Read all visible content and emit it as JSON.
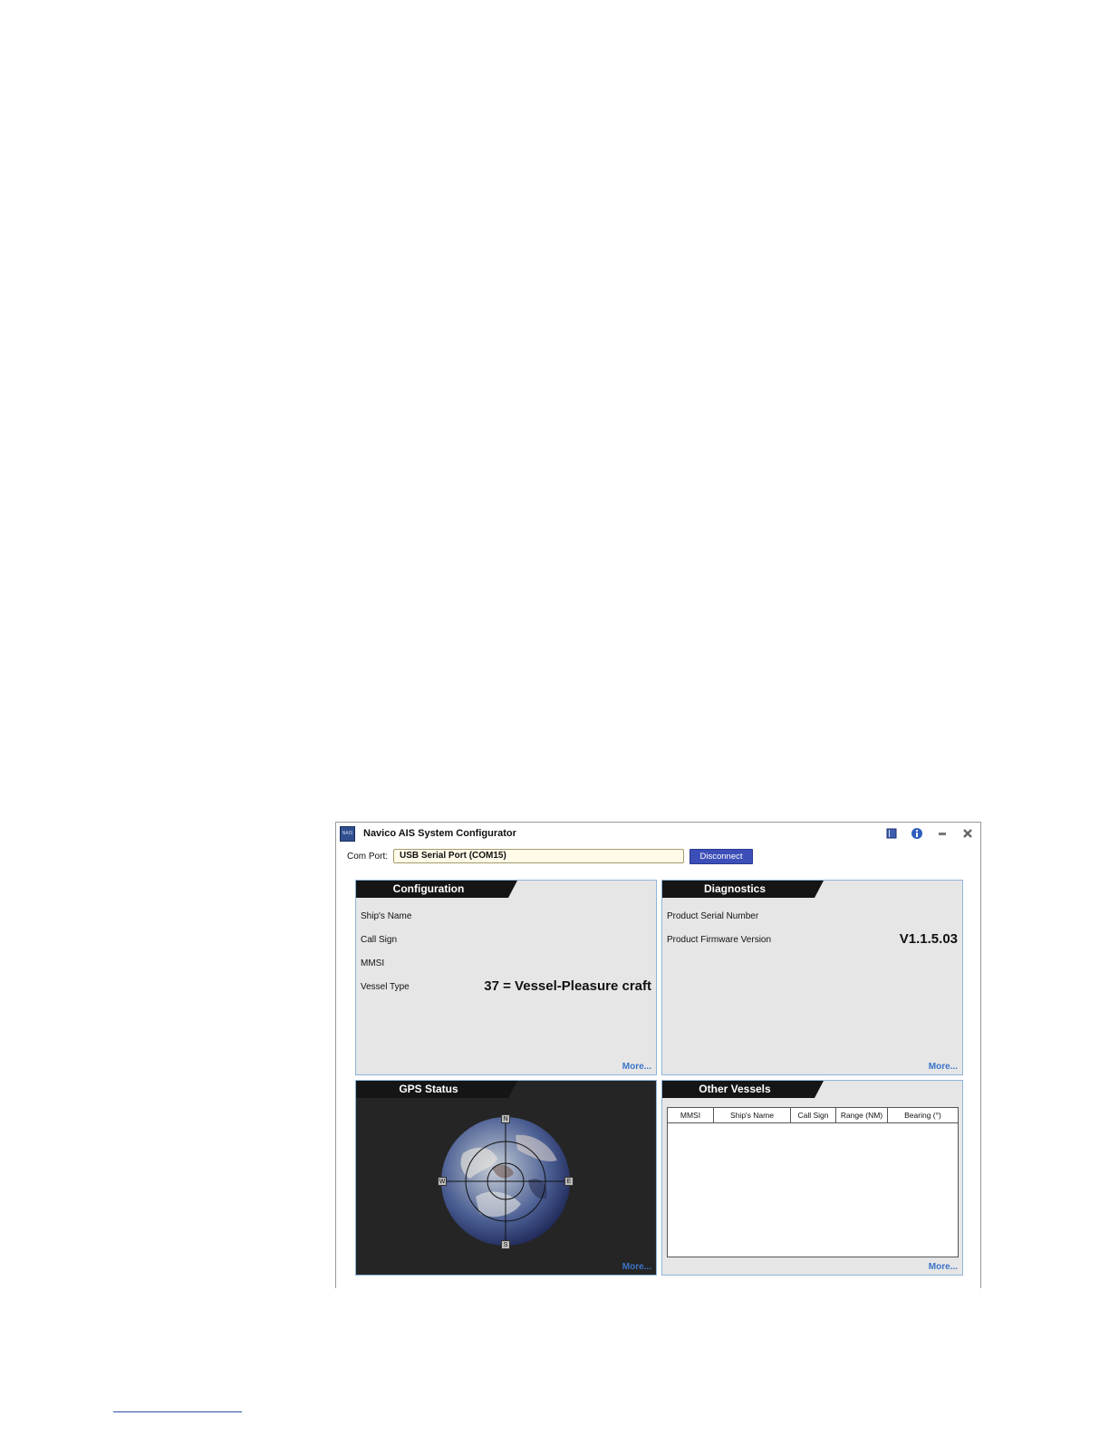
{
  "window": {
    "title": "Navico AIS System Configurator",
    "logo_text": "NAIS"
  },
  "titlebar_icons": [
    "book-icon",
    "info-icon",
    "minimize-icon",
    "close-icon"
  ],
  "com": {
    "label": "Com Port:",
    "value": "USB Serial Port (COM15)",
    "disconnect_label": "Disconnect"
  },
  "configuration": {
    "title": "Configuration",
    "fields": [
      {
        "label": "Ship's Name",
        "value": ""
      },
      {
        "label": "Call Sign",
        "value": ""
      },
      {
        "label": "MMSI",
        "value": ""
      },
      {
        "label": "Vessel Type",
        "value": "37 = Vessel-Pleasure craft"
      }
    ],
    "more": "More..."
  },
  "diagnostics": {
    "title": "Diagnostics",
    "fields": [
      {
        "label": "Product Serial Number",
        "value": ""
      },
      {
        "label": "Product Firmware Version",
        "value": "V1.1.5.03"
      }
    ],
    "more": "More..."
  },
  "gps": {
    "title": "GPS Status",
    "compass": {
      "n": "N",
      "s": "S",
      "e": "E",
      "w": "W"
    },
    "more": "More..."
  },
  "vessels": {
    "title": "Other Vessels",
    "columns": [
      "MMSI",
      "Ship's Name",
      "Call Sign",
      "Range (NM)",
      "Bearing (°)"
    ],
    "rows": [],
    "more": "More..."
  },
  "colors": {
    "accent": "#3c4fb8",
    "panel_border": "#8fb4dc",
    "more_link": "#3a73c9"
  }
}
